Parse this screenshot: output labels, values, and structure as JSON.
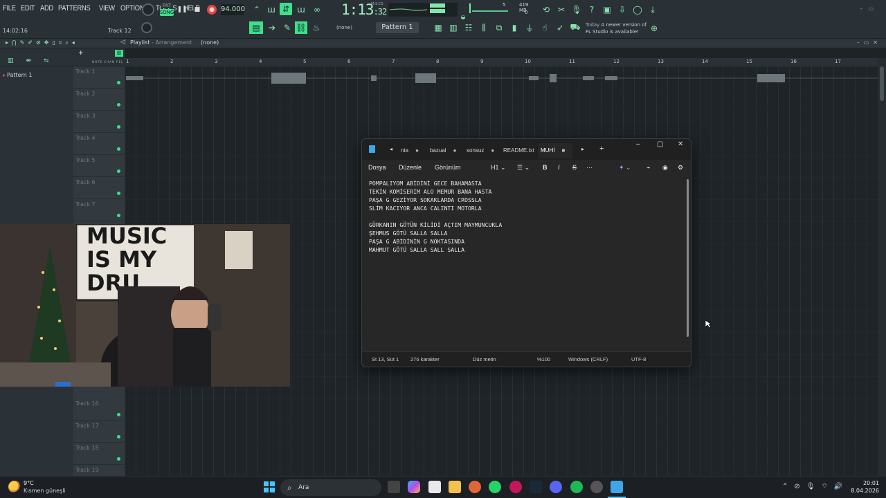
{
  "fl": {
    "menu": [
      "FILE",
      "EDIT",
      "ADD",
      "PATTERNS",
      "VIEW",
      "OPTIONS",
      "TOOLS",
      "HELP"
    ],
    "song_mode": "SONG",
    "pat_mode": "PAT",
    "bpm": "94.000",
    "time_main": "1:13",
    "time_sub": ":32",
    "time_unit": "M:S:CS",
    "cpu_num": "5",
    "mem": "419 MB",
    "poly": "0",
    "hint_time": "14:02:16",
    "hint_track": "Track 12",
    "none_label": "(none)",
    "pattern_selector": "Pattern 1",
    "news_date": "Today",
    "news_line1": "A newer version of",
    "news_line2": "FL Studio is available!"
  },
  "playlist": {
    "title": "Playlist",
    "subtitle": "- Arrangement",
    "selector": "(none)",
    "pattern_item": "Pattern 1",
    "ruler": [
      "1",
      "2",
      "3",
      "4",
      "5",
      "6",
      "7",
      "8",
      "9",
      "10",
      "11",
      "12",
      "13",
      "14",
      "15",
      "16",
      "17"
    ],
    "tracks_top": [
      "Track 1",
      "Track 2",
      "Track 3",
      "Track 4",
      "Track 5",
      "Track 6",
      "Track 7"
    ],
    "tracks_bottom": [
      "Track 16",
      "Track 17",
      "Track 18",
      "Track 19"
    ]
  },
  "notepad": {
    "tabs": [
      "nta",
      "bazual",
      "sonsuz",
      "README.txt",
      "MUHİ"
    ],
    "menu": [
      "Dosya",
      "Düzenle",
      "Görünüm"
    ],
    "heading": "H1",
    "lines": [
      "POMPALIYOM ABİDİNİ GECE BAHAMASTA",
      "TEKİN KOMİSERİM ALO MEMUR BANA HASTA",
      "PAŞA G GEZİYOR SOKAKLARDA CROSSLA",
      "SLİM KACIYOR ANCA CALINTI MOTORLA",
      "",
      "GÜRKANIN GÖTÜN KİLİDİ AÇTIM MAYMUNCUKLA",
      "ŞEHMUS GÖTÜ SALLA SALLA",
      "PAŞA G ABİDİNİN G NOKTASINDA",
      "MAHMUT GÖTÜ SALLA SALL SALLA"
    ],
    "status": {
      "position": "St 13, Süt 1",
      "chars": "276 karakter",
      "format": "Düz metin",
      "zoom": "%100",
      "eol": "Windows (CRLF)",
      "encoding": "UTF-8"
    }
  },
  "taskbar": {
    "temp": "9°C",
    "weather": "Kısmen güneşli",
    "search": "Ara",
    "time": "20:01",
    "date": "8.04.2026"
  },
  "colors": {
    "fl_accent": "#3ee08a",
    "notepad_bg": "#272727"
  }
}
